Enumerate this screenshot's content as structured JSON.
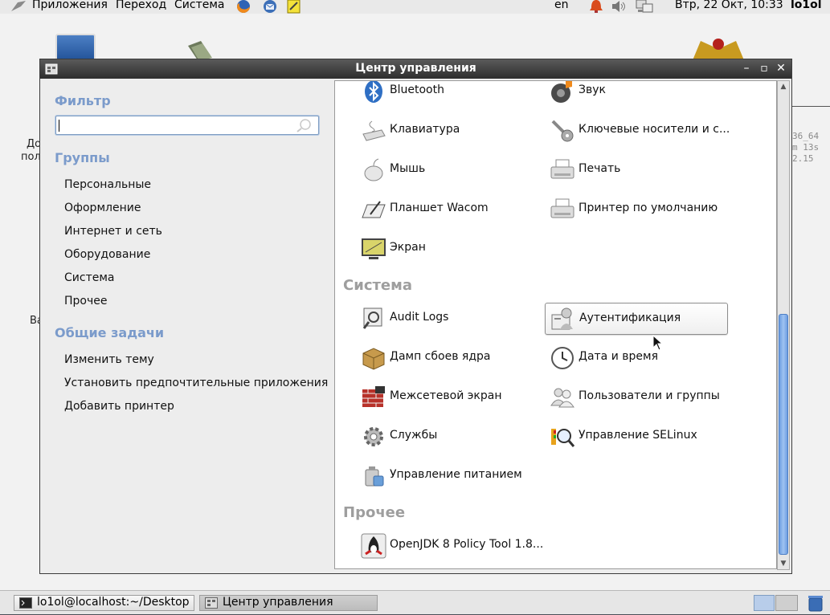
{
  "top_panel": {
    "menus": [
      "Приложения",
      "Переход",
      "Система"
    ],
    "lang": "en",
    "clock": "Втр, 22 Окт, 10:33",
    "user": "lo1ol"
  },
  "desktop": {
    "labels": [
      "До",
      "пол",
      "Ва"
    ],
    "terminal_text": [
      "36_64",
      "m 13s",
      "2.15"
    ]
  },
  "window": {
    "title": "Центр управления"
  },
  "sidebar": {
    "filter_heading": "Фильтр",
    "search_value": "",
    "groups_heading": "Группы",
    "groups": [
      "Персональные",
      "Оформление",
      "Интернет и сеть",
      "Оборудование",
      "Система",
      "Прочее"
    ],
    "tasks_heading": "Общие задачи",
    "tasks": [
      "Изменить тему",
      "Установить предпочтительные приложения",
      "Добавить принтер"
    ]
  },
  "content": {
    "hardware_items": [
      {
        "label": "Bluetooth",
        "icon": "bluetooth-icon"
      },
      {
        "label": "Звук",
        "icon": "sound-icon"
      },
      {
        "label": "Клавиатура",
        "icon": "keyboard-icon"
      },
      {
        "label": "Ключевые носители и с...",
        "icon": "key-icon"
      },
      {
        "label": "Мышь",
        "icon": "mouse-icon"
      },
      {
        "label": "Печать",
        "icon": "printer-icon"
      },
      {
        "label": "Планшет Wacom",
        "icon": "tablet-icon"
      },
      {
        "label": "Принтер по умолчанию",
        "icon": "printer-icon"
      },
      {
        "label": "Экран",
        "icon": "display-icon"
      }
    ],
    "system_heading": "Система",
    "system_items": [
      {
        "label": "Audit Logs",
        "icon": "audit-icon"
      },
      {
        "label": "Аутентификация",
        "icon": "auth-icon"
      },
      {
        "label": "Дамп сбоев ядра",
        "icon": "package-icon"
      },
      {
        "label": "Дата и время",
        "icon": "clock-icon"
      },
      {
        "label": "Межсетевой экран",
        "icon": "firewall-icon"
      },
      {
        "label": "Пользователи и группы",
        "icon": "users-icon"
      },
      {
        "label": "Службы",
        "icon": "gear-icon"
      },
      {
        "label": "Управление SELinux",
        "icon": "selinux-icon"
      },
      {
        "label": "Управление питанием",
        "icon": "power-icon"
      }
    ],
    "other_heading": "Прочее",
    "other_items": [
      {
        "label": "OpenJDK 8 Policy Tool 1.8...",
        "icon": "java-icon"
      }
    ]
  },
  "taskbar": {
    "items": [
      "lo1ol@localhost:~/Desktop",
      "Центр управления"
    ]
  }
}
